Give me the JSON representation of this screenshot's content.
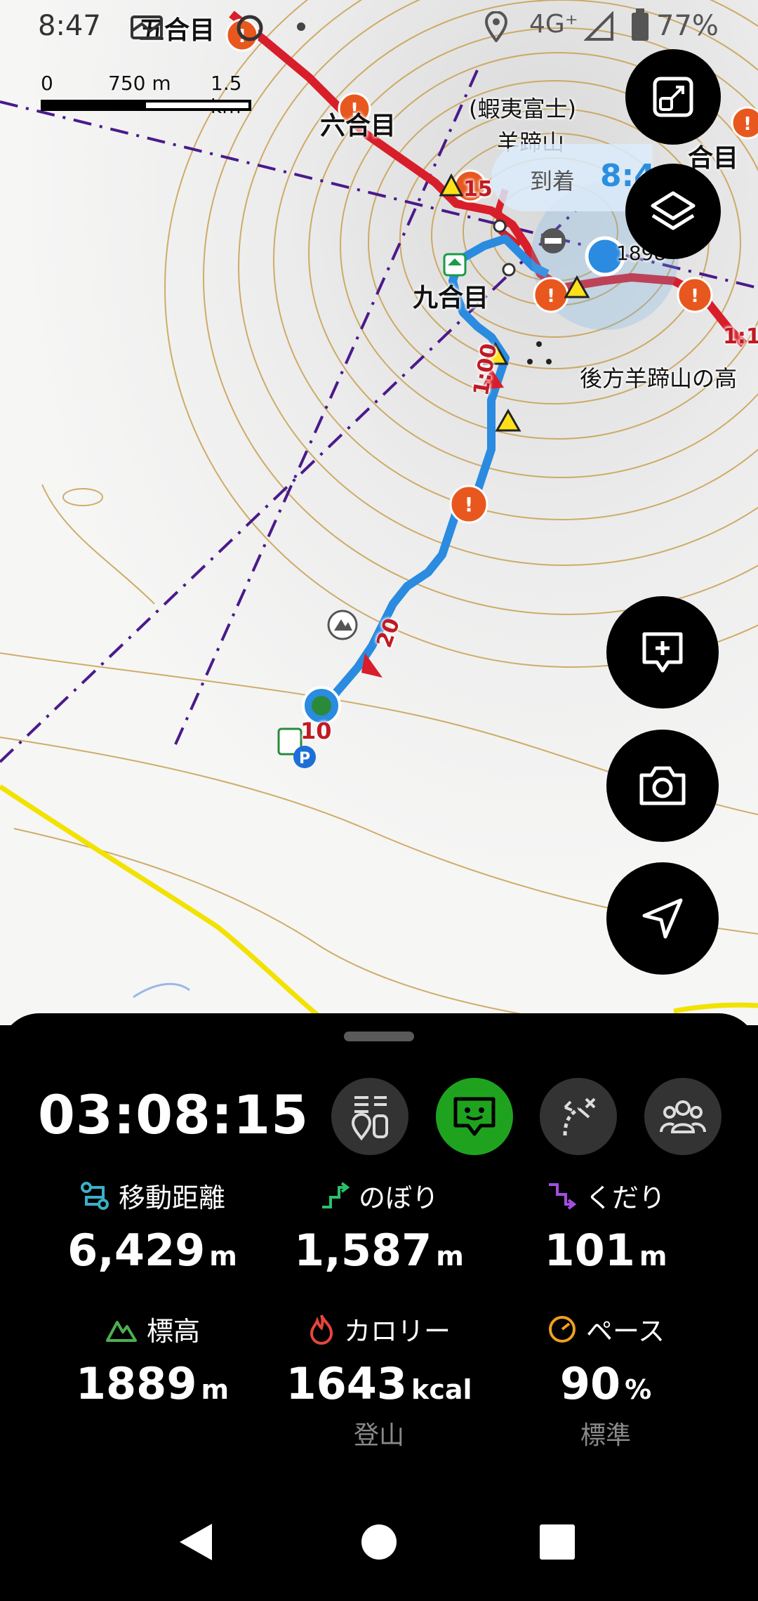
{
  "status_bar": {
    "time": "8:47",
    "network": "4G⁺",
    "battery": "77%"
  },
  "scale": {
    "zero": "0",
    "mid": "750 m",
    "end": "1.5 km"
  },
  "map_labels": {
    "goume": "五合目",
    "rokume": "六合目",
    "kyume": "九合目",
    "ezofuji": "(蝦夷富士)",
    "yoteizan": "羊蹄山",
    "gouhou": "後方羊蹄山の高",
    "gome_right": "合目",
    "time_1_00": "1:00",
    "time_1_1": "1:1",
    "km_20": "20",
    "km_10": "10",
    "km_15": "15",
    "elev_small": "1898"
  },
  "arrival": {
    "label": "到着",
    "time": "8:4"
  },
  "panel": {
    "elapsed": "03:08:15",
    "stats": {
      "distance": {
        "label": "移動距離",
        "value": "6,429",
        "unit": "m"
      },
      "ascent": {
        "label": "のぼり",
        "value": "1,587",
        "unit": "m"
      },
      "descent": {
        "label": "くだり",
        "value": "101",
        "unit": "m"
      },
      "altitude": {
        "label": "標高",
        "value": "1889",
        "unit": "m"
      },
      "calorie": {
        "label": "カロリー",
        "value": "1643",
        "unit": "kcal",
        "sub": "登山"
      },
      "pace": {
        "label": "ペース",
        "value": "90",
        "unit": "%",
        "sub": "標準"
      }
    }
  },
  "colors": {
    "route_blue": "#2a8be0",
    "route_red": "#d81e2a",
    "active_green": "#1fa31f"
  }
}
